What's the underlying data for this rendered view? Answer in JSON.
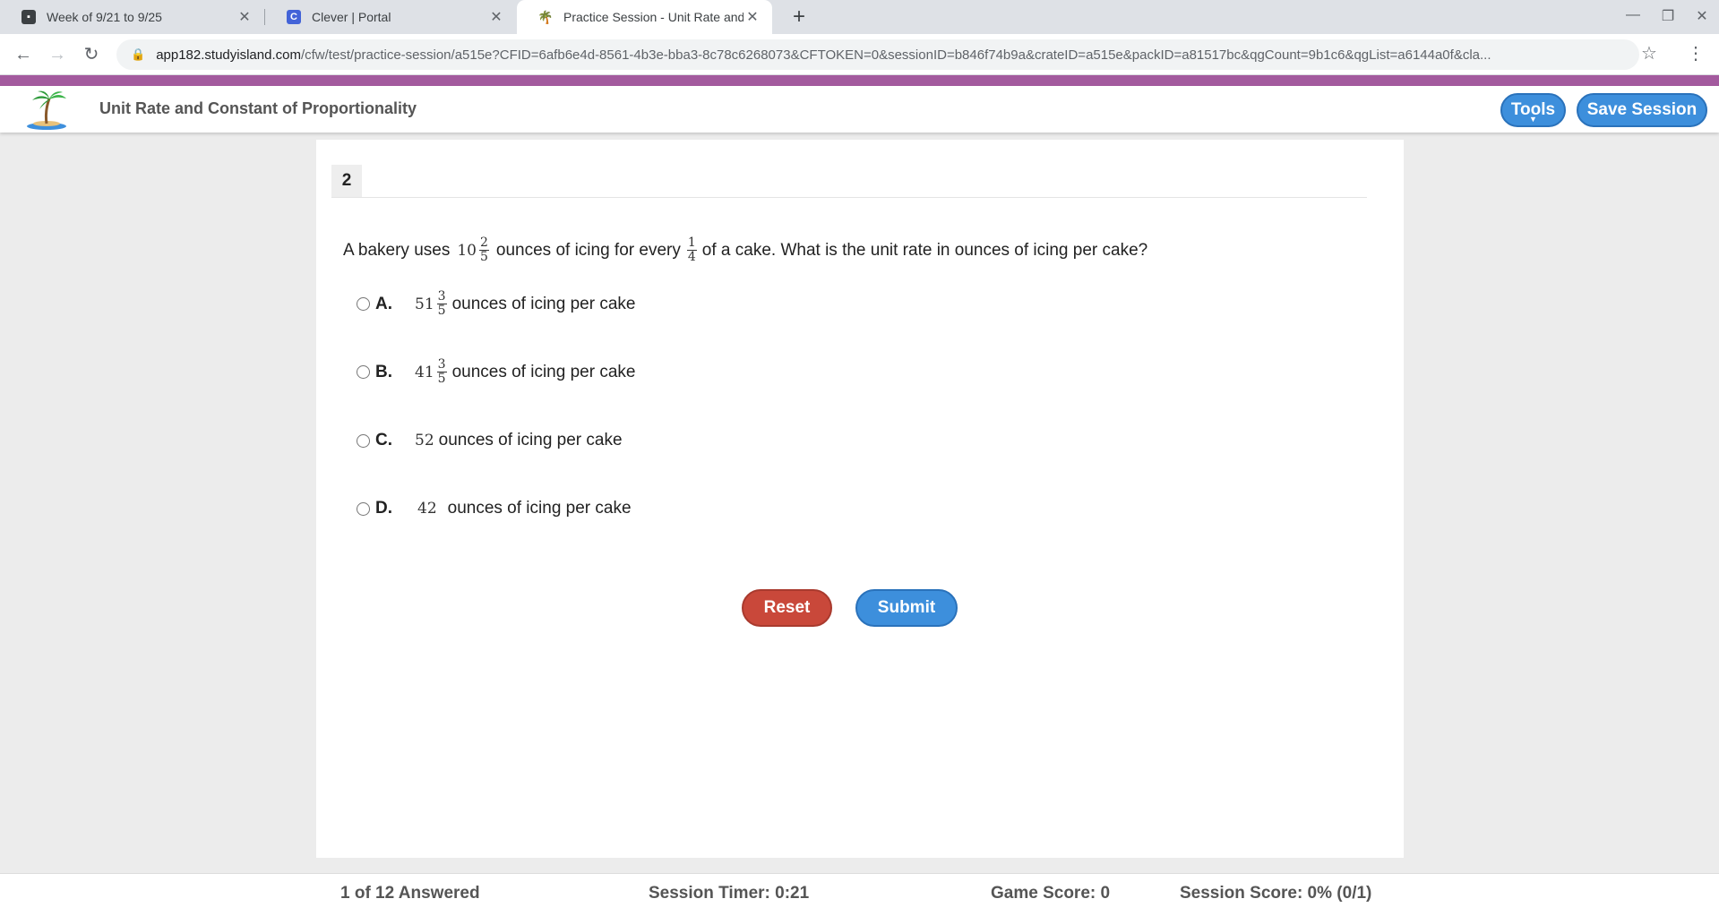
{
  "browser": {
    "tabs": [
      {
        "title": "Week of 9/21 to 9/25",
        "favicon": "classroom-icon"
      },
      {
        "title": "Clever | Portal",
        "favicon": "clever-icon",
        "favicon_text": "C"
      },
      {
        "title": "Practice Session - Unit Rate and C",
        "favicon": "palm-tree-icon"
      }
    ],
    "url_host": "app182.studyisland.com",
    "url_path": "/cfw/test/practice-session/a515e?CFID=6afb6e4d-8561-4b3e-bba3-8c78c6268073&CFTOKEN=0&sessionID=b846f74b9a&crateID=a515e&packID=a81517bc&qgCount=9b1c6&qgList=a6144a0f&cla..."
  },
  "header": {
    "title": "Unit Rate and Constant of Proportionality",
    "tools_label": "Tools",
    "save_label": "Save Session"
  },
  "question": {
    "number": "2",
    "text_1": "A bakery uses",
    "amount_whole": "10",
    "amount_num": "2",
    "amount_den": "5",
    "text_2": "ounces of icing for every",
    "part_num": "1",
    "part_den": "4",
    "text_3": "of a cake. What is the unit rate in ounces of icing per cake?"
  },
  "choices": [
    {
      "letter": "A.",
      "whole": "51",
      "num": "3",
      "den": "5",
      "text": "ounces of icing per cake"
    },
    {
      "letter": "B.",
      "whole": "41",
      "num": "3",
      "den": "5",
      "text": "ounces of icing per cake"
    },
    {
      "letter": "C.",
      "whole": "52",
      "text": "ounces of icing per cake"
    },
    {
      "letter": "D.",
      "whole": "42",
      "text": "ounces of icing per cake"
    }
  ],
  "actions": {
    "reset": "Reset",
    "submit": "Submit"
  },
  "footer": {
    "answered": "1 of 12 Answered",
    "timer": "Session Timer: 0:21",
    "game_score": "Game Score: 0",
    "session_score": "Session Score: 0% (0/1)"
  },
  "colors": {
    "header_strip": "#a35a9e",
    "primary_button": "#3d8fdc",
    "reset_button": "#c9483a"
  }
}
